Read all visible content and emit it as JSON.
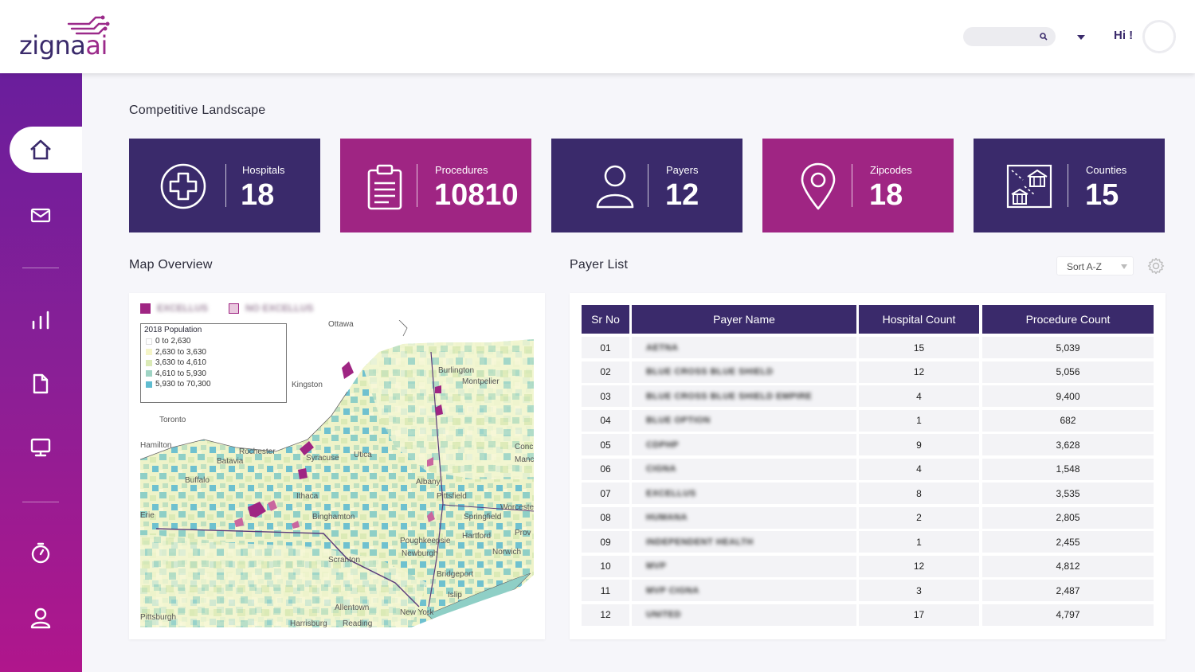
{
  "header": {
    "logo": {
      "part1": "zigna",
      "part2": "ai"
    },
    "greeting": "Hi !",
    "search_placeholder": ""
  },
  "sidebar": {
    "items": [
      {
        "name": "home",
        "icon": "home-icon",
        "active": true
      },
      {
        "name": "messages",
        "icon": "mail-icon"
      },
      {
        "name": "analytics",
        "icon": "bar-chart-icon"
      },
      {
        "name": "documents",
        "icon": "document-icon"
      },
      {
        "name": "monitor",
        "icon": "monitor-icon"
      },
      {
        "name": "timer",
        "icon": "stopwatch-icon"
      },
      {
        "name": "profile",
        "icon": "user-icon"
      }
    ]
  },
  "main": {
    "title": "Competitive Landscape",
    "cards": [
      {
        "label": "Hospitals",
        "value": "18",
        "icon": "hospital-cross-icon",
        "color": "#3a2a6b"
      },
      {
        "label": "Procedures",
        "value": "10810",
        "icon": "clipboard-icon",
        "color": "#9f2583"
      },
      {
        "label": "Payers",
        "value": "12",
        "icon": "user-icon",
        "color": "#3a2a6b"
      },
      {
        "label": "Zipcodes",
        "value": "18",
        "icon": "location-pin-icon",
        "color": "#9f2583"
      },
      {
        "label": "Counties",
        "value": "15",
        "icon": "county-map-icon",
        "color": "#3a2a6b"
      }
    ]
  },
  "map": {
    "title": "Map Overview",
    "legend_top": [
      {
        "label": "EXCELLUS",
        "color": "#9f2583"
      },
      {
        "label": "NO EXCELLUS",
        "color": "#e9c8de"
      }
    ],
    "population_legend": {
      "title": "2018 Population",
      "ranges": [
        {
          "label": "0 to 2,630",
          "color": "#ffffff"
        },
        {
          "label": "2,630 to 3,630",
          "color": "#f5f5c8"
        },
        {
          "label": "3,630 to 4,610",
          "color": "#dbeab6"
        },
        {
          "label": "4,610 to 5,930",
          "color": "#9fd4c4"
        },
        {
          "label": "5,930 to 70,300",
          "color": "#5fbcd0"
        }
      ]
    },
    "place_labels": [
      "Ottawa",
      "Kingston",
      "Toronto",
      "Hamilton",
      "Burlington",
      "Montpelier",
      "Rochester",
      "Syracuse",
      "Utica",
      "Batavia",
      "Buffalo",
      "Albany",
      "Pittsfield",
      "Ithaca",
      "Erie",
      "Binghamton",
      "Springfield",
      "Worcester",
      "Conc",
      "Manc",
      "Prov",
      "Hartford",
      "Norwich",
      "Poughkeepsie",
      "Newburgh",
      "Scranton",
      "Bridgeport",
      "Islip",
      "Allentown",
      "New York",
      "Pittsburgh",
      "Harrisburg",
      "Reading"
    ]
  },
  "payers": {
    "title": "Payer List",
    "sort_label": "Sort A-Z",
    "columns": [
      "Sr No",
      "Payer Name",
      "Hospital Count",
      "Procedure Count"
    ],
    "rows": [
      {
        "sr": "01",
        "name": "AETNA",
        "hospitals": "15",
        "procedures": "5,039"
      },
      {
        "sr": "02",
        "name": "BLUE CROSS BLUE SHIELD",
        "hospitals": "12",
        "procedures": "5,056"
      },
      {
        "sr": "03",
        "name": "BLUE CROSS BLUE SHIELD EMPIRE",
        "hospitals": "4",
        "procedures": "9,400"
      },
      {
        "sr": "04",
        "name": "BLUE OPTION",
        "hospitals": "1",
        "procedures": "682"
      },
      {
        "sr": "05",
        "name": "CDPHP",
        "hospitals": "9",
        "procedures": "3,628"
      },
      {
        "sr": "06",
        "name": "CIGNA",
        "hospitals": "4",
        "procedures": "1,548"
      },
      {
        "sr": "07",
        "name": "EXCELLUS",
        "hospitals": "8",
        "procedures": "3,535"
      },
      {
        "sr": "08",
        "name": "HUMANA",
        "hospitals": "2",
        "procedures": "2,805"
      },
      {
        "sr": "09",
        "name": "INDEPENDENT HEALTH",
        "hospitals": "1",
        "procedures": "2,455"
      },
      {
        "sr": "10",
        "name": "MVP",
        "hospitals": "12",
        "procedures": "4,812"
      },
      {
        "sr": "11",
        "name": "MVP CIGNA",
        "hospitals": "3",
        "procedures": "2,487"
      },
      {
        "sr": "12",
        "name": "UNITED",
        "hospitals": "17",
        "procedures": "4,797"
      }
    ]
  }
}
